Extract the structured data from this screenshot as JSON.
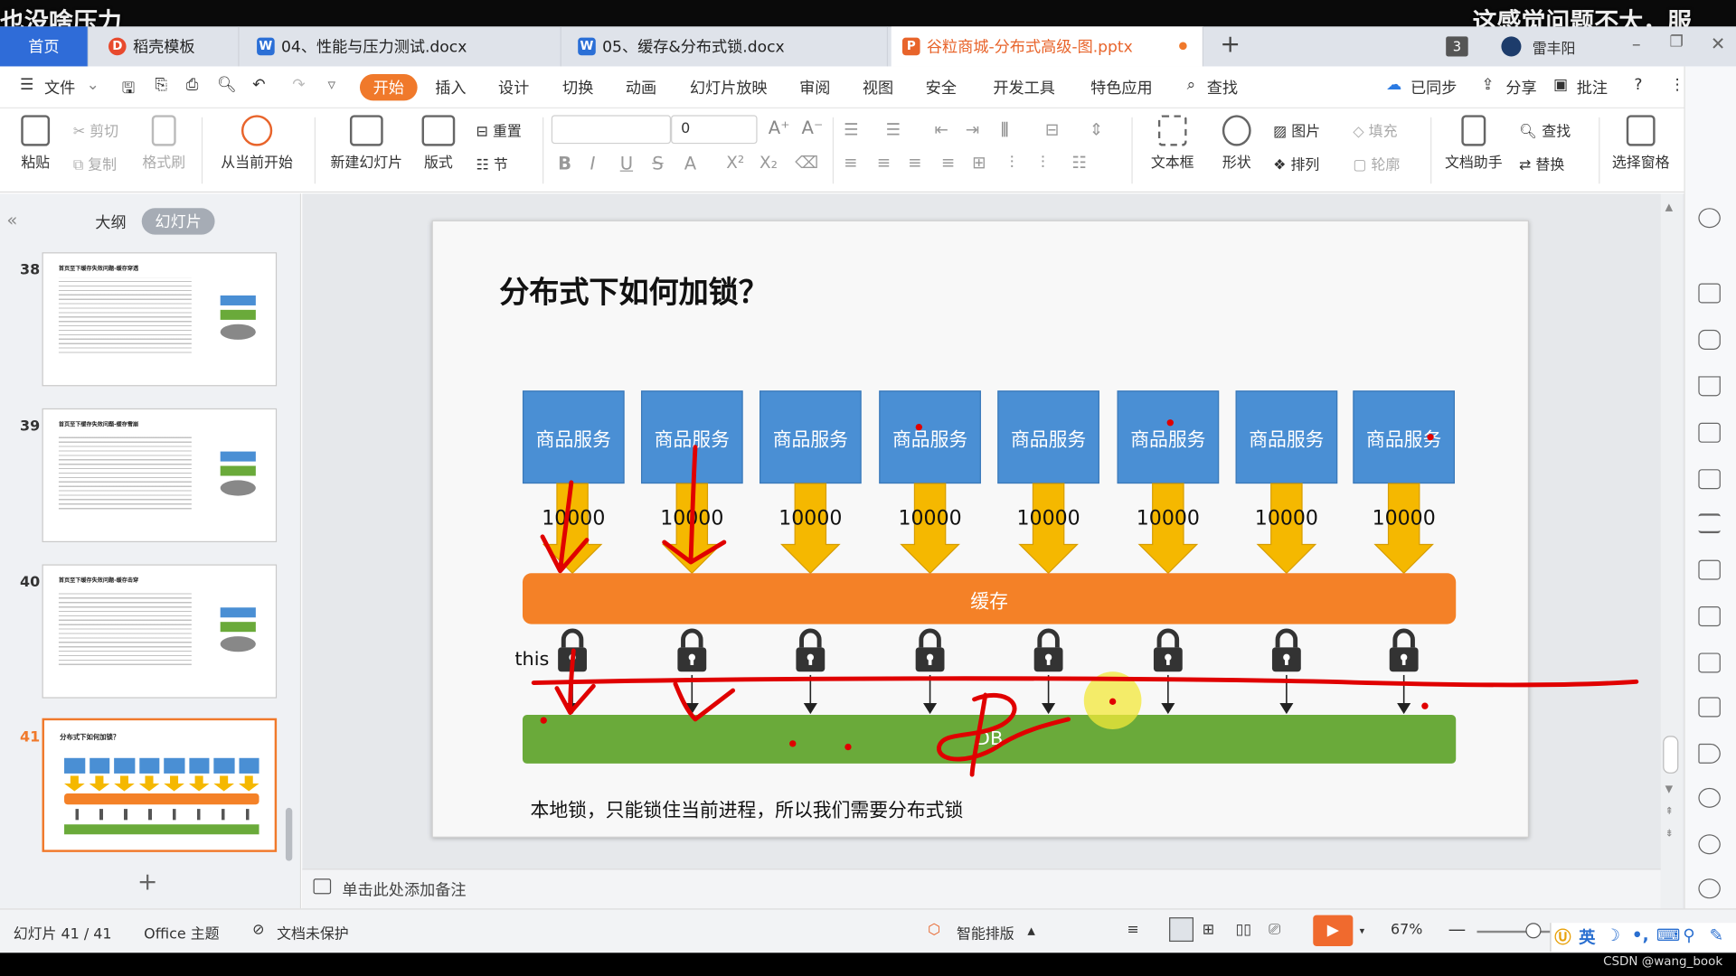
{
  "overlay": {
    "left_text": "也没啥压力",
    "right_text": "这感觉问题不大，服"
  },
  "tabs": {
    "home": "首页",
    "items": [
      {
        "label": "稻壳模板",
        "icon": "daoke-icon"
      },
      {
        "label": "04、性能与压力测试.docx",
        "icon": "word-icon"
      },
      {
        "label": "05、缓存&分布式锁.docx",
        "icon": "word-icon"
      },
      {
        "label": "谷粒商城-分布式高级-图.pptx",
        "icon": "ppt-icon"
      }
    ],
    "new_tab": "+",
    "window_count": "3",
    "user": "雷丰阳"
  },
  "menu": {
    "file": "文件",
    "items": [
      "开始",
      "插入",
      "设计",
      "切换",
      "动画",
      "幻灯片放映",
      "审阅",
      "视图",
      "安全",
      "开发工具",
      "特色应用"
    ],
    "active": "开始",
    "search": "查找",
    "synced": "已同步",
    "share": "分享",
    "comment": "批注"
  },
  "ribbon": {
    "paste": "粘贴",
    "cut": "剪切",
    "copy": "复制",
    "format_painter": "格式刷",
    "from_current": "从当前开始",
    "new_slide": "新建幻灯片",
    "layout": "版式",
    "reset": "重置",
    "section": "节",
    "font_size": "0",
    "textbox": "文本框",
    "shape": "形状",
    "picture": "图片",
    "arrange": "排列",
    "fill": "填充",
    "outline": "轮廓",
    "doc_assistant": "文档助手",
    "find": "查找",
    "replace": "替换",
    "select_pane": "选择窗格"
  },
  "left_panel": {
    "outline_tab": "大纲",
    "slides_tab": "幻灯片",
    "slides": [
      {
        "num": "38",
        "title": "首页至下缓存失效问题-缓存穿透"
      },
      {
        "num": "39",
        "title": "首页至下缓存失效问题-缓存雪崩"
      },
      {
        "num": "40",
        "title": "首页至下缓存失效问题-缓存击穿"
      },
      {
        "num": "41",
        "title": "分布式下如何加锁？"
      }
    ],
    "add": "+"
  },
  "slide": {
    "title": "分布式下如何加锁？",
    "services": [
      "商品服务",
      "商品服务",
      "商品服务",
      "商品服务",
      "商品服务",
      "商品服务",
      "商品服务",
      "商品服务"
    ],
    "counts": [
      "10000",
      "10000",
      "10000",
      "10000",
      "10000",
      "10000",
      "10000",
      "10000"
    ],
    "cache_label": "缓存",
    "db_label": "DB",
    "this_label": "this",
    "note": "本地锁，只能锁住当前进程，所以我们需要分布式锁",
    "colors": {
      "service": "#4a8fd4",
      "arrow": "#f5b800",
      "cache": "#f48127",
      "db": "#6aaa3a",
      "ink": "#e00000"
    }
  },
  "notes_placeholder": "单击此处添加备注",
  "status": {
    "slide_pos": "幻灯片 41 / 41",
    "theme": "Office 主题",
    "protect": "文档未保护",
    "smart_layout": "智能排版",
    "zoom": "67%",
    "ime": "英",
    "watermark": "CSDN @wang_book"
  }
}
